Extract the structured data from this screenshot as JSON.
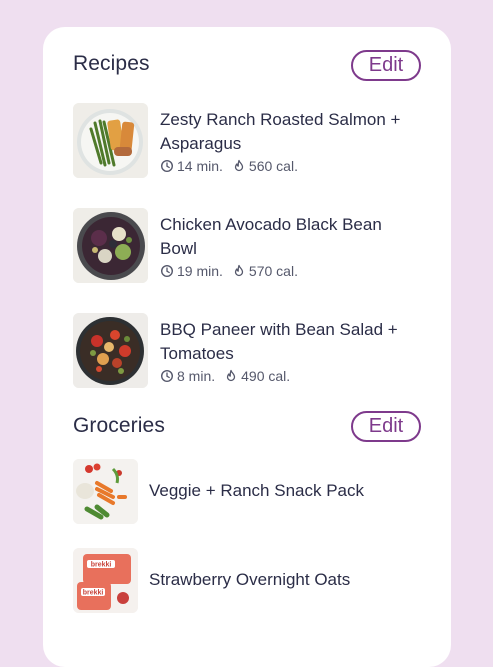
{
  "recipes": {
    "title": "Recipes",
    "edit_label": "Edit",
    "items": [
      {
        "name": "Zesty Ranch Roasted Salmon + Asparagus",
        "time": "14 min.",
        "calories": "560 cal."
      },
      {
        "name": "Chicken Avocado Black Bean Bowl",
        "time": "19 min.",
        "calories": "570 cal."
      },
      {
        "name": "BBQ Paneer with Bean Salad + Tomatoes",
        "time": "8 min.",
        "calories": "490 cal."
      }
    ]
  },
  "groceries": {
    "title": "Groceries",
    "edit_label": "Edit",
    "items": [
      {
        "name": "Veggie + Ranch Snack Pack"
      },
      {
        "name": "Strawberry Overnight Oats",
        "package_text": "brekki"
      }
    ]
  },
  "colors": {
    "background": "#efdff0",
    "card": "#ffffff",
    "accent": "#7e3a8c",
    "text": "#2b2d47",
    "muted": "#55586b"
  },
  "icons": {
    "time": "clock-icon",
    "calories": "flame-icon"
  }
}
